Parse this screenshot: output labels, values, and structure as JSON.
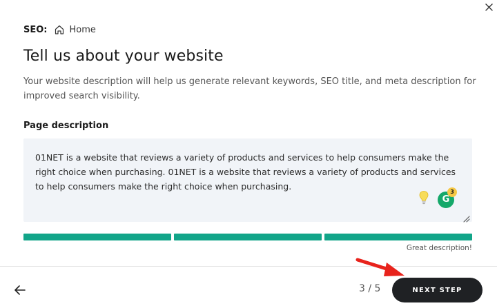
{
  "breadcrumb": {
    "section": "SEO:",
    "icon": "home-icon",
    "page": "Home"
  },
  "heading": {
    "title": "Tell us about your website",
    "subtitle": "Your website description will help us generate relevant keywords, SEO title, and meta description for improved search visibility."
  },
  "field": {
    "label": "Page description",
    "value": "01NET is a website that reviews a variety of products and services to help consumers make the right choice when purchasing. 01NET is a website that reviews a variety of products and services to help consumers make the right choice when purchasing."
  },
  "grammarly": {
    "letter": "G",
    "count": "3"
  },
  "quality": {
    "segments_filled": 3,
    "segments_total": 3,
    "caption": "Great description!",
    "color": "#12a589"
  },
  "footer": {
    "step": "3 / 5",
    "next_label": "NEXT STEP"
  },
  "colors": {
    "accent": "#12a589",
    "button_bg": "#1f2124",
    "annotation_arrow": "#e8231c"
  }
}
